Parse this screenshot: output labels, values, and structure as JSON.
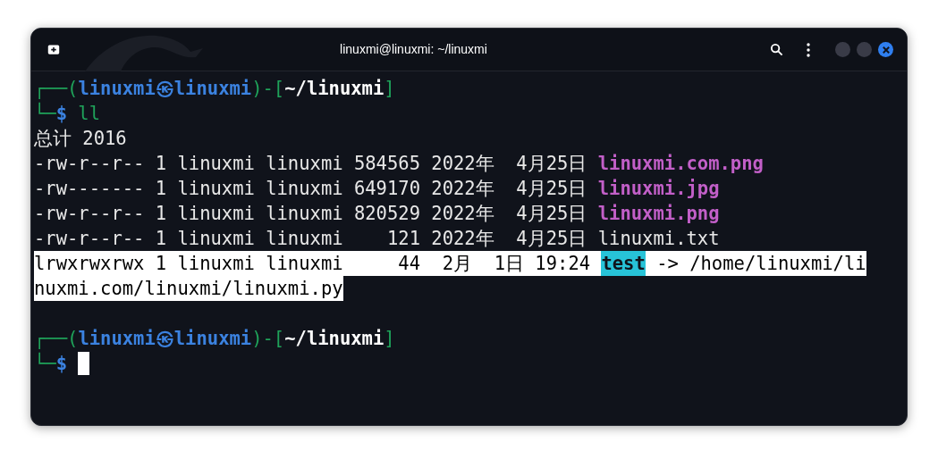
{
  "window": {
    "title": "linuxmi@linuxmi: ~/linuxmi"
  },
  "terminal": {
    "cursor": true,
    "lines": [
      {
        "selected": false,
        "segments": [
          {
            "kind": "frame",
            "text": "┌──("
          },
          {
            "kind": "user",
            "text": "linuxmi㉿linuxmi"
          },
          {
            "kind": "frame",
            "text": ")-["
          },
          {
            "kind": "path",
            "text": "~/linuxmi"
          },
          {
            "kind": "frame",
            "text": "]"
          }
        ]
      },
      {
        "selected": false,
        "segments": [
          {
            "kind": "frame",
            "text": "└─"
          },
          {
            "kind": "prompt",
            "text": "$"
          },
          {
            "kind": "command",
            "text": " ll"
          }
        ]
      },
      {
        "selected": false,
        "segments": [
          {
            "kind": "text",
            "text": "总计 2016"
          }
        ]
      },
      {
        "selected": false,
        "segments": [
          {
            "kind": "text",
            "text": "-rw-r--r-- 1 linuxmi linuxmi 584565 2022年  4月25日 "
          },
          {
            "kind": "image",
            "text": "linuxmi.com.png"
          }
        ]
      },
      {
        "selected": false,
        "segments": [
          {
            "kind": "text",
            "text": "-rw------- 1 linuxmi linuxmi 649170 2022年  4月25日 "
          },
          {
            "kind": "image",
            "text": "linuxmi.jpg"
          }
        ]
      },
      {
        "selected": false,
        "segments": [
          {
            "kind": "text",
            "text": "-rw-r--r-- 1 linuxmi linuxmi 820529 2022年  4月25日 "
          },
          {
            "kind": "image",
            "text": "linuxmi.png"
          }
        ]
      },
      {
        "selected": false,
        "segments": [
          {
            "kind": "text",
            "text": "-rw-r--r-- 1 linuxmi linuxmi    121 2022年  4月25日 linuxmi.txt"
          }
        ]
      },
      {
        "selected": true,
        "segments": [
          {
            "kind": "text",
            "text": "lrwxrwxrwx 1 linuxmi linuxmi     44  2月  1日 19:24 "
          },
          {
            "kind": "link",
            "text": "test"
          },
          {
            "kind": "text",
            "text": " -> /home/linuxmi/li"
          }
        ]
      },
      {
        "selected": true,
        "segments": [
          {
            "kind": "text",
            "text": "nuxmi.com/linuxmi/linuxmi.py"
          }
        ]
      },
      {
        "selected": false
      },
      {
        "selected": false,
        "segments": [
          {
            "kind": "frame",
            "text": "┌──("
          },
          {
            "kind": "user",
            "text": "linuxmi㉿linuxmi"
          },
          {
            "kind": "frame",
            "text": ")-["
          },
          {
            "kind": "path",
            "text": "~/linuxmi"
          },
          {
            "kind": "frame",
            "text": "]"
          }
        ]
      },
      {
        "selected": false,
        "segments": [
          {
            "kind": "frame",
            "text": "└─"
          },
          {
            "kind": "prompt",
            "text": "$"
          }
        ]
      }
    ]
  }
}
